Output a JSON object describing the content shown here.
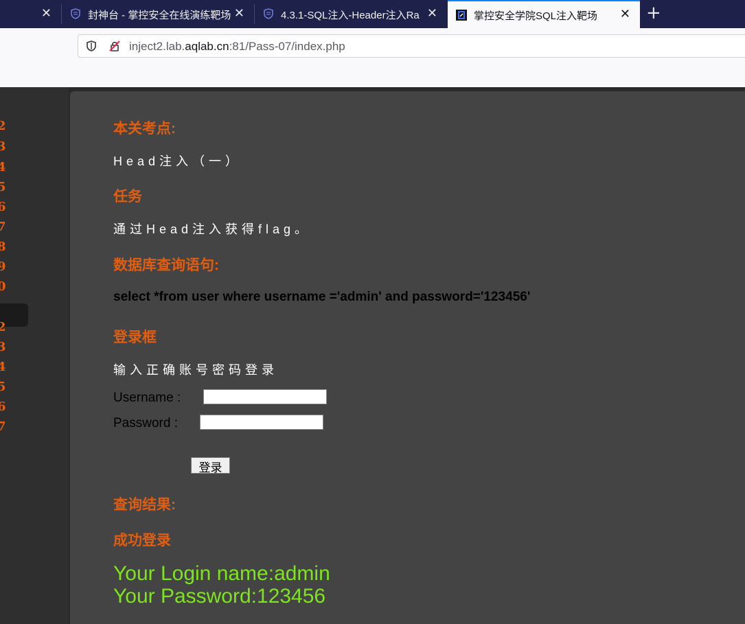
{
  "browser": {
    "tabs": [
      {
        "title": ""
      },
      {
        "title": "封神台 - 掌控安全在线演练靶场"
      },
      {
        "title": "4.3.1-SQL注入-Header注入Ra"
      },
      {
        "title": "掌控安全学院SQL注入靶场"
      }
    ],
    "close_glyph": "✕",
    "new_tab_glyph": "+",
    "url": {
      "pre": "inject2.lab.",
      "host": "aqlab.cn",
      "post": ":81/Pass-07/index.php"
    }
  },
  "sidebar": {
    "numbers": [
      "2",
      "3",
      "4",
      "5",
      "6",
      "7",
      "8",
      "9",
      "0",
      "2",
      "3",
      "4",
      "5",
      "6",
      "7"
    ],
    "selected": "7"
  },
  "page": {
    "h_point": "本关考点:",
    "point_text": "Head注入（一）",
    "h_task": "任务",
    "task_text": "通过Head注入获得flag。",
    "h_sql": "数据库查询语句:",
    "sql": "select *from user where username ='admin' and password='123456'",
    "h_login": "登录框",
    "login_hint": "输入正确账号密码登录",
    "username_label": "Username :",
    "password_label": "Password :",
    "login_button": "登录",
    "h_result": "查询结果:",
    "success": "成功登录",
    "login_name": "Your Login name:admin",
    "password_result": "Your Password:123456"
  },
  "colors": {
    "heading": "#e25d0f",
    "result": "#7ce61a",
    "accent": "#0a84ff"
  }
}
